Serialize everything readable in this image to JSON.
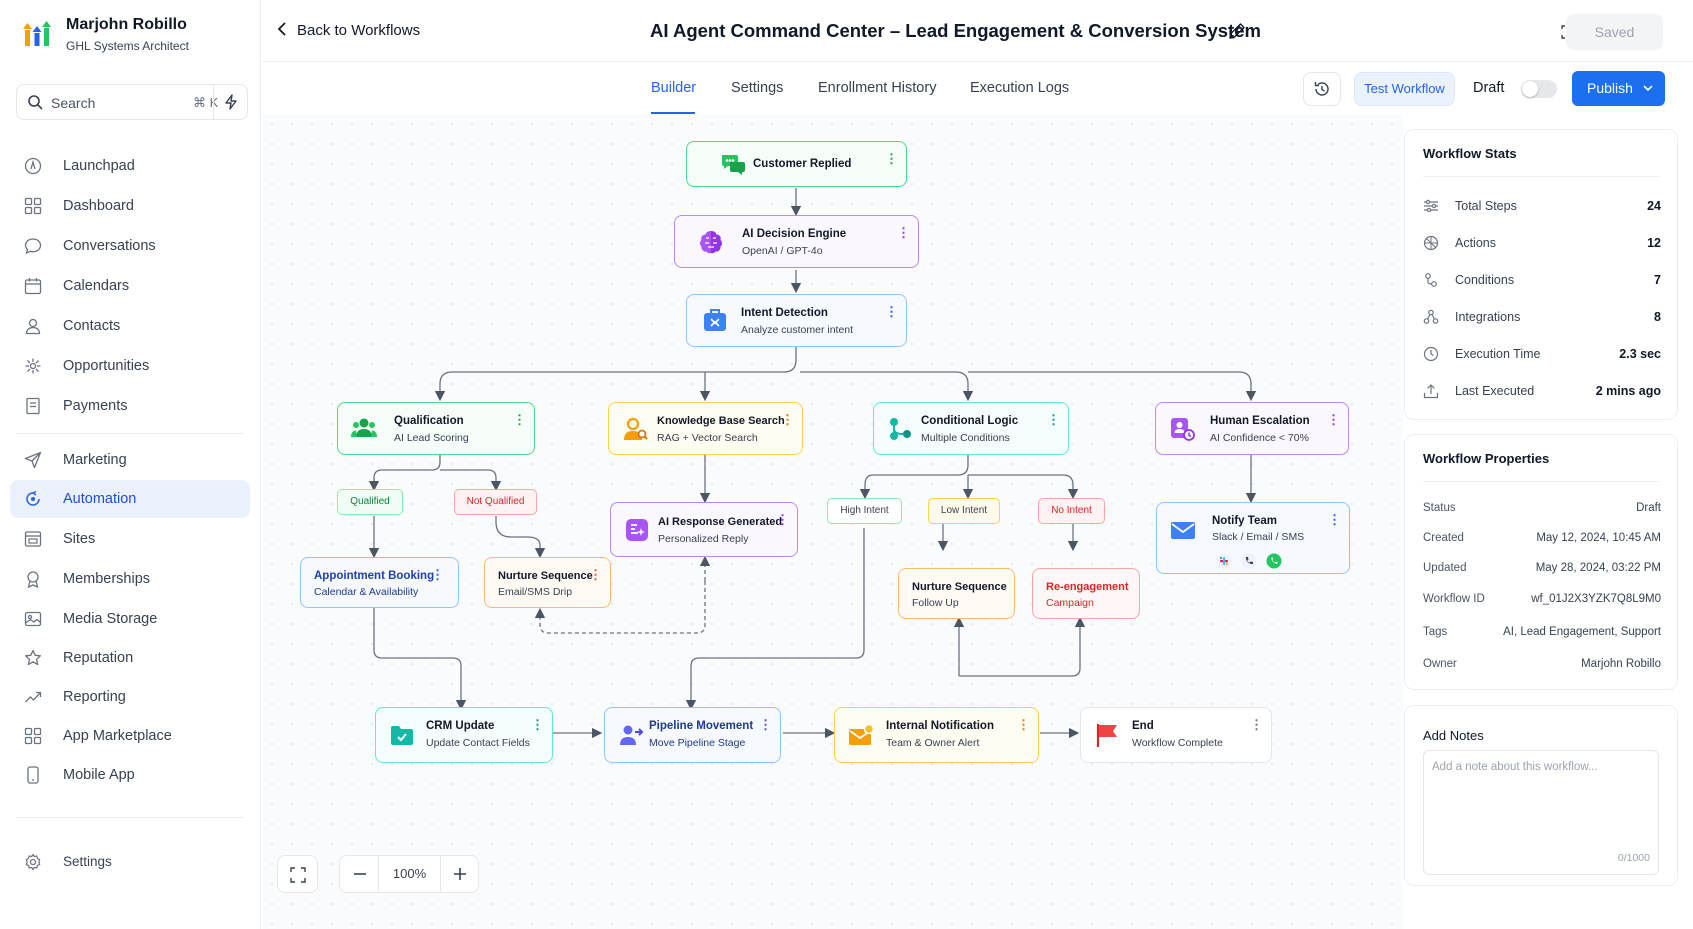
{
  "user": {
    "name": "Marjohn Robillo",
    "role": "GHL Systems Architect"
  },
  "search": {
    "label": "Search",
    "shortcut": "⌘ K"
  },
  "nav": {
    "items": [
      {
        "label": "Launchpad",
        "icon": "rocket-icon"
      },
      {
        "label": "Dashboard",
        "icon": "grid-icon"
      },
      {
        "label": "Conversations",
        "icon": "chat-icon"
      },
      {
        "label": "Calendars",
        "icon": "calendar-icon"
      },
      {
        "label": "Contacts",
        "icon": "contacts-icon"
      },
      {
        "label": "Opportunities",
        "icon": "opportunities-icon"
      },
      {
        "label": "Payments",
        "icon": "payments-icon"
      },
      {
        "label": "Marketing",
        "icon": "send-icon"
      },
      {
        "label": "Automation",
        "icon": "automation-icon"
      },
      {
        "label": "Sites",
        "icon": "sites-icon"
      },
      {
        "label": "Memberships",
        "icon": "award-icon"
      },
      {
        "label": "Media Storage",
        "icon": "image-icon"
      },
      {
        "label": "Reputation",
        "icon": "star-icon"
      },
      {
        "label": "Reporting",
        "icon": "trend-icon"
      },
      {
        "label": "App Marketplace",
        "icon": "apps-icon"
      },
      {
        "label": "Mobile App",
        "icon": "mobile-icon"
      }
    ],
    "active": "Automation",
    "settings": "Settings"
  },
  "header": {
    "back": "Back to Workflows",
    "title": "AI Agent Command Center – Lead Engagement & Conversion System",
    "saved": "Saved"
  },
  "tabs": [
    "Builder",
    "Settings",
    "Enrollment History",
    "Execution Logs"
  ],
  "active_tab": "Builder",
  "toolbar": {
    "test": "Test Workflow",
    "draft": "Draft",
    "draft_enabled": false,
    "publish": "Publish"
  },
  "nodes": {
    "customer_replied": {
      "title": "Customer Replied"
    },
    "ai_decision": {
      "title": "AI Decision Engine",
      "sub": "OpenAI / GPT-4o"
    },
    "intent": {
      "title": "Intent Detection",
      "sub": "Analyze customer intent"
    },
    "qualification": {
      "title": "Qualification",
      "sub": "AI Lead Scoring"
    },
    "kb_search": {
      "title": "Knowledge Base Search",
      "sub": "RAG + Vector Search"
    },
    "cond_logic": {
      "title": "Conditional Logic",
      "sub": "Multiple Conditions"
    },
    "human_esc": {
      "title": "Human Escalation",
      "sub": "AI Confidence < 70%"
    },
    "ai_response": {
      "title": "AI Response Generated",
      "sub": "Personalized Reply"
    },
    "notify": {
      "title": "Notify Team",
      "sub": "Slack / Email / SMS"
    },
    "appointment": {
      "title": "Appointment Booking",
      "sub": "Calendar & Availability"
    },
    "nurture1": {
      "title": "Nurture Sequence",
      "sub": "Email/SMS Drip"
    },
    "nurture2": {
      "title": "Nurture Sequence",
      "sub": "Follow Up"
    },
    "reengage": {
      "title": "Re-engagement",
      "sub": "Campaign"
    },
    "crm": {
      "title": "CRM Update",
      "sub": "Update Contact Fields"
    },
    "pipeline": {
      "title": "Pipeline Movement",
      "sub": "Move Pipeline Stage"
    },
    "internal": {
      "title": "Internal Notification",
      "sub": "Team & Owner Alert"
    },
    "end": {
      "title": "End",
      "sub": "Workflow Complete"
    }
  },
  "badges": {
    "qualified": "Qualified",
    "not_qualified": "Not Qualified",
    "high": "High Intent",
    "low": "Low Intent",
    "no": "No Intent"
  },
  "zoom": "100%",
  "stats": {
    "title": "Workflow Stats",
    "rows": [
      {
        "label": "Total Steps",
        "value": "24"
      },
      {
        "label": "Actions",
        "value": "12"
      },
      {
        "label": "Conditions",
        "value": "7"
      },
      {
        "label": "Integrations",
        "value": "8"
      },
      {
        "label": "Execution Time",
        "value": "2.3 sec"
      },
      {
        "label": "Last Executed",
        "value": "2 mins ago"
      }
    ]
  },
  "properties": {
    "title": "Workflow Properties",
    "rows": [
      {
        "label": "Status",
        "value": "Draft"
      },
      {
        "label": "Created",
        "value": "May 12, 2024, 10:45 AM"
      },
      {
        "label": "Updated",
        "value": "May 28, 2024, 03:22 PM"
      },
      {
        "label": "Workflow ID",
        "value": "wf_01J2X3YZK7Q8L9M0"
      },
      {
        "label": "Tags",
        "value": "AI, Lead Engagement, Support"
      },
      {
        "label": "Owner",
        "value": "Marjohn Robillo"
      }
    ]
  },
  "notes": {
    "title": "Add Notes",
    "placeholder": "Add a note about this workflow...",
    "counter": "0/1000"
  },
  "colors": {
    "accent": "#2563eb",
    "publish": "#1d6ff2",
    "active_nav_bg": "#eaf1fd"
  }
}
